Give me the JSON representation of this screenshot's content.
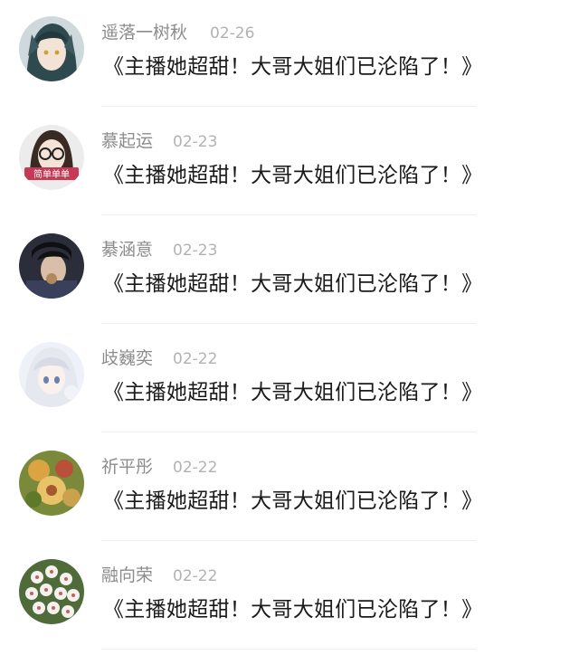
{
  "comments": [
    {
      "name": "遥落一树秋",
      "date": "02-26",
      "text": "《主播她超甜！大哥大姐们已沦陷了！》",
      "avatar": "anime-character-avatar"
    },
    {
      "name": "慕起运",
      "date": "02-23",
      "text": "《主播她超甜！大哥大姐们已沦陷了！》",
      "avatar": "girl-with-glasses-avatar",
      "avatar_caption": "简单单单"
    },
    {
      "name": "綦涵意",
      "date": "02-23",
      "text": "《主播她超甜！大哥大姐们已沦陷了！》",
      "avatar": "dark-photo-avatar"
    },
    {
      "name": "歧巍奕",
      "date": "02-22",
      "text": "《主播她超甜！大哥大姐们已沦陷了！》",
      "avatar": "anime-white-hair-avatar"
    },
    {
      "name": "祈平彤",
      "date": "02-22",
      "text": "《主播她超甜！大哥大姐们已沦陷了！》",
      "avatar": "food-platter-avatar"
    },
    {
      "name": "融向荣",
      "date": "02-22",
      "text": "《主播她超甜！大哥大姐们已沦陷了！》",
      "avatar": "flower-cluster-avatar"
    }
  ]
}
